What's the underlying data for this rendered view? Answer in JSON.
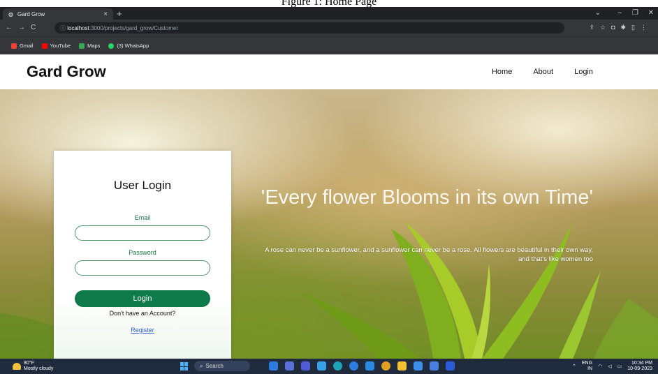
{
  "caption": "Figure 1: Home Page",
  "browser": {
    "tab_title": "Gard Grow",
    "tab_close": "×",
    "new_tab": "+",
    "url_host": "localhost",
    "url_path": ":3000/projects/gard_grow/Customer",
    "bookmarks": [
      {
        "label": "Gmail",
        "color": "#ea4335"
      },
      {
        "label": "YouTube",
        "color": "#ff0000"
      },
      {
        "label": "Maps",
        "color": "#34a853"
      },
      {
        "label": "(3) WhatsApp",
        "color": "#25d366"
      }
    ]
  },
  "site": {
    "brand": "Gard Grow",
    "nav": [
      "Home",
      "About",
      "Login"
    ]
  },
  "login": {
    "title": "User Login",
    "email_label": "Email",
    "password_label": "Password",
    "button": "Login",
    "no_account": "Don't have an Account?",
    "register": "Register"
  },
  "hero": {
    "quote": "'Every flower Blooms in its own Time'",
    "subtext": "A rose can never be a sunflower, and a sunflower can never be a rose. All flowers are beautiful in their own way, and that's like women too"
  },
  "taskbar": {
    "temp": "80°F",
    "weather": "Mostly cloudy",
    "search": "Search",
    "lang": "ENG",
    "region": "IN",
    "time": "10:34 PM",
    "date": "10-09-2023"
  },
  "colors": {
    "accent": "#0f7a4a",
    "label_green": "#17733f",
    "link": "#2b5bd7"
  }
}
